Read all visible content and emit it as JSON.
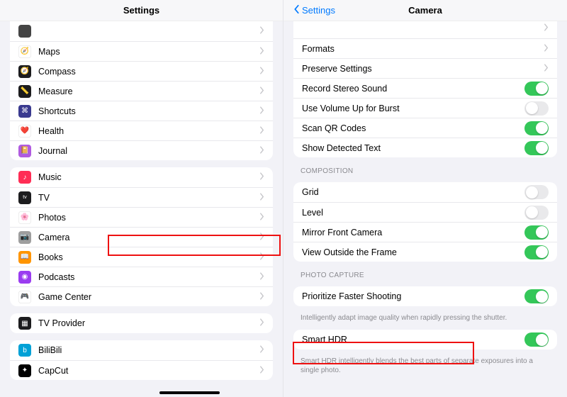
{
  "leftTitle": "Settings",
  "back": "Settings",
  "rightTitle": "Camera",
  "leftGroups": [
    [
      {
        "label": "",
        "bg": "#444",
        "glyph": ""
      },
      {
        "label": "Maps",
        "bg": "#fff",
        "glyph": "🧭",
        "border": true
      },
      {
        "label": "Compass",
        "bg": "#1c1c1e",
        "glyph": "🧭"
      },
      {
        "label": "Measure",
        "bg": "#1c1c1e",
        "glyph": "📏"
      },
      {
        "label": "Shortcuts",
        "bg": "#3a3a8f",
        "glyph": "⌘"
      },
      {
        "label": "Health",
        "bg": "#fff",
        "glyph": "❤️",
        "border": true
      },
      {
        "label": "Journal",
        "bg": "#b05be0",
        "glyph": "📔"
      }
    ],
    [
      {
        "label": "Music",
        "bg": "#ff2d55",
        "glyph": "♪"
      },
      {
        "label": "TV",
        "bg": "#1c1c1e",
        "glyph": "tv",
        "fs": "7px"
      },
      {
        "label": "Photos",
        "bg": "#fff",
        "glyph": "🌸",
        "border": true
      },
      {
        "label": "Camera",
        "bg": "#9e9e9e",
        "glyph": "📷"
      },
      {
        "label": "Books",
        "bg": "#ff9500",
        "glyph": "📖"
      },
      {
        "label": "Podcasts",
        "bg": "#9a3cf0",
        "glyph": "◉"
      },
      {
        "label": "Game Center",
        "bg": "#fff",
        "glyph": "🎮",
        "border": true
      }
    ],
    [
      {
        "label": "TV Provider",
        "bg": "#1c1c1e",
        "glyph": "▦"
      }
    ],
    [
      {
        "label": "BiliBili",
        "bg": "#00a1d6",
        "glyph": "b"
      },
      {
        "label": "CapCut",
        "bg": "#000",
        "glyph": "✦"
      }
    ]
  ],
  "detail": {
    "g1": [
      {
        "kind": "nav",
        "label": ""
      },
      {
        "kind": "nav",
        "label": "Formats"
      },
      {
        "kind": "nav",
        "label": "Preserve Settings"
      },
      {
        "kind": "toggle",
        "label": "Record Stereo Sound",
        "on": true
      },
      {
        "kind": "toggle",
        "label": "Use Volume Up for Burst",
        "on": false
      },
      {
        "kind": "toggle",
        "label": "Scan QR Codes",
        "on": true
      },
      {
        "kind": "toggle",
        "label": "Show Detected Text",
        "on": true
      }
    ],
    "h2": "COMPOSITION",
    "g2": [
      {
        "kind": "toggle",
        "label": "Grid",
        "on": false
      },
      {
        "kind": "toggle",
        "label": "Level",
        "on": false
      },
      {
        "kind": "toggle",
        "label": "Mirror Front Camera",
        "on": true
      },
      {
        "kind": "toggle",
        "label": "View Outside the Frame",
        "on": true
      }
    ],
    "h3": "PHOTO CAPTURE",
    "g3": [
      {
        "kind": "toggle",
        "label": "Prioritize Faster Shooting",
        "on": true
      }
    ],
    "f3": "Intelligently adapt image quality when rapidly pressing the shutter.",
    "g4": [
      {
        "kind": "toggle",
        "label": "Smart HDR",
        "on": true
      }
    ],
    "f4": "Smart HDR intelligently blends the best parts of separate exposures into a single photo."
  }
}
